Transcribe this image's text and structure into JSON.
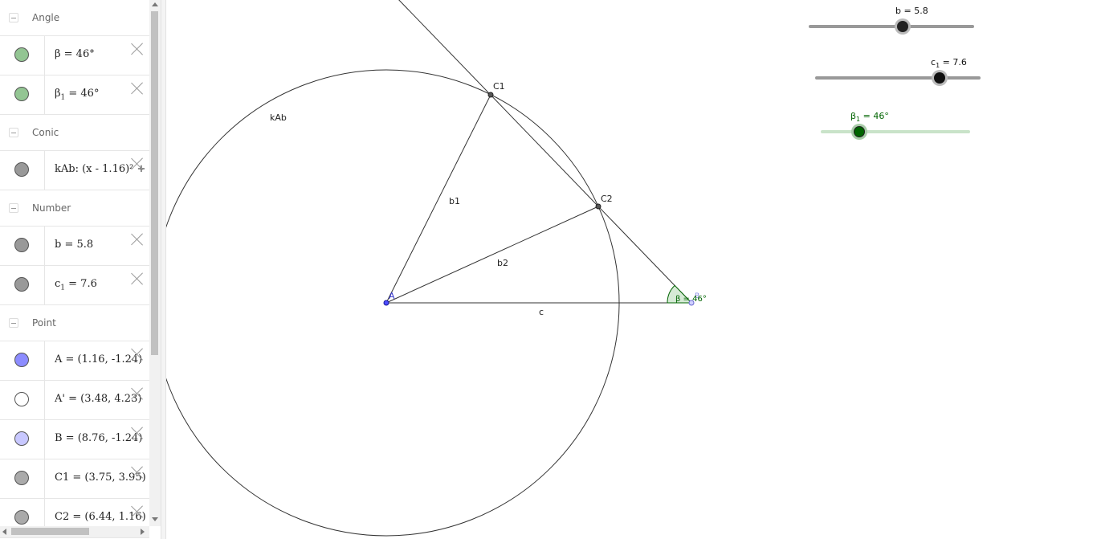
{
  "algebra": {
    "groups": [
      {
        "name": "Angle",
        "items": [
          {
            "def": "β = 46°",
            "color": "#93c593"
          },
          {
            "def_main": "β",
            "def_sub": "1",
            "def_rest": " = 46°",
            "color": "#93c593"
          }
        ]
      },
      {
        "name": "Conic",
        "items": [
          {
            "def": "kAb: (x - 1.16)² + (",
            "color": "#999999"
          }
        ]
      },
      {
        "name": "Number",
        "items": [
          {
            "def": "b = 5.8",
            "color": "#999999"
          },
          {
            "def_main": "c",
            "def_sub": "1",
            "def_rest": " = 7.6",
            "color": "#999999"
          }
        ]
      },
      {
        "name": "Point",
        "items": [
          {
            "def": "A = (1.16, -1.24)",
            "color": "#8c8cff"
          },
          {
            "def": "A' = (3.48, 4.23)",
            "color": "#ffffff"
          },
          {
            "def": "B = (8.76, -1.24)",
            "color": "#c8c8ff"
          },
          {
            "def": "C1 = (3.75, 3.95)",
            "color": "#aaaaaa"
          },
          {
            "def": "C2 = (6.44, 1.16)",
            "color": "#aaaaaa"
          }
        ]
      }
    ]
  },
  "graphics": {
    "labels": {
      "kAb": "kAb",
      "C1": "C1",
      "C2": "C2",
      "b1": "b1",
      "b2": "b2",
      "c": "c",
      "A": "A",
      "B": "B",
      "beta": "β = 46°"
    },
    "sliders": [
      {
        "name": "b",
        "label_main": "b",
        "label_sub": "",
        "label_rest": " = 5.8",
        "value": 5.8,
        "fraction": 0.57,
        "color": "#000000",
        "track_color": "#999999"
      },
      {
        "name": "c1",
        "label_main": "c",
        "label_sub": "1",
        "label_rest": " = 7.6",
        "value": 7.6,
        "fraction": 0.75,
        "color": "#000000",
        "track_color": "#999999"
      },
      {
        "name": "beta1",
        "label_main": "β",
        "label_sub": "1",
        "label_rest": " = 46°",
        "value": 46,
        "fraction": 0.26,
        "color": "#006400",
        "track_color": "#c9e3c9"
      }
    ]
  }
}
